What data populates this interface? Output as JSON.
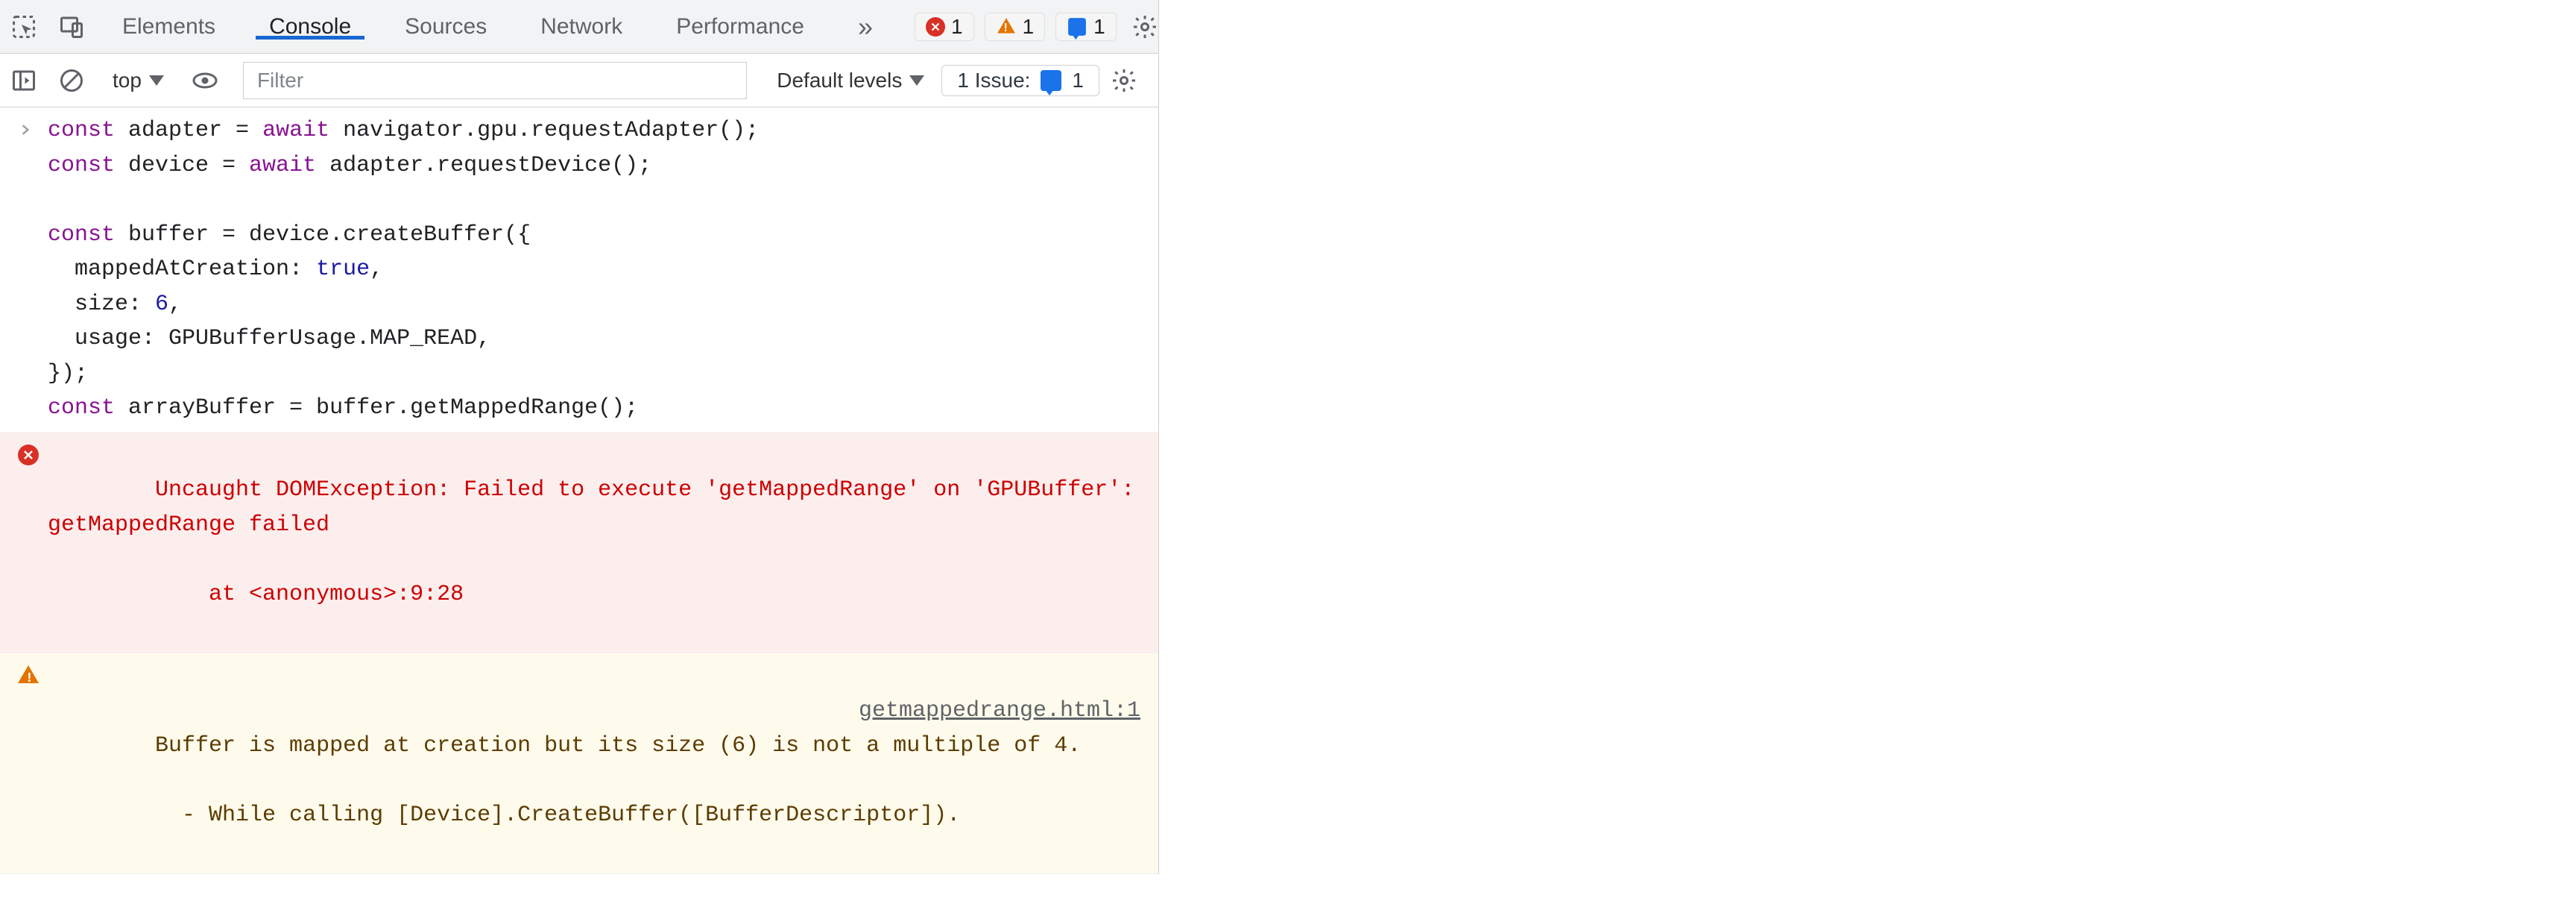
{
  "tabs": {
    "items": [
      "Elements",
      "Console",
      "Sources",
      "Network",
      "Performance"
    ],
    "active_index": 1,
    "overflow_glyph": "»"
  },
  "badges": {
    "errors": "1",
    "warnings": "1",
    "info": "1"
  },
  "toolbar": {
    "context": "top",
    "filter_placeholder": "Filter",
    "levels_label": "Default levels",
    "issues_label": "1 Issue:",
    "issues_count": "1"
  },
  "console": {
    "input": {
      "lines": [
        [
          [
            "kw",
            "const"
          ],
          [
            "txt",
            " adapter = "
          ],
          [
            "kw",
            "await"
          ],
          [
            "txt",
            " navigator.gpu.requestAdapter();"
          ]
        ],
        [
          [
            "kw",
            "const"
          ],
          [
            "txt",
            " device = "
          ],
          [
            "kw",
            "await"
          ],
          [
            "txt",
            " adapter.requestDevice();"
          ]
        ],
        [
          [
            "txt",
            ""
          ]
        ],
        [
          [
            "kw",
            "const"
          ],
          [
            "txt",
            " buffer = device.createBuffer({"
          ]
        ],
        [
          [
            "txt",
            "  mappedAtCreation: "
          ],
          [
            "lit",
            "true"
          ],
          [
            "txt",
            ","
          ]
        ],
        [
          [
            "txt",
            "  size: "
          ],
          [
            "num",
            "6"
          ],
          [
            "txt",
            ","
          ]
        ],
        [
          [
            "txt",
            "  usage: GPUBufferUsage.MAP_READ,"
          ]
        ],
        [
          [
            "txt",
            "});"
          ]
        ],
        [
          [
            "kw",
            "const"
          ],
          [
            "txt",
            " arrayBuffer = buffer.getMappedRange();"
          ]
        ]
      ]
    },
    "error": {
      "message": "Uncaught DOMException: Failed to execute 'getMappedRange' on 'GPUBuffer': getMappedRange failed",
      "stack": "    at <anonymous>:9:28"
    },
    "warning": {
      "message": "Buffer is mapped at creation but its size (6) is not a multiple of 4.",
      "detail": "  - While calling [Device].CreateBuffer([BufferDescriptor]).",
      "source": "getmappedrange.html:1"
    }
  }
}
